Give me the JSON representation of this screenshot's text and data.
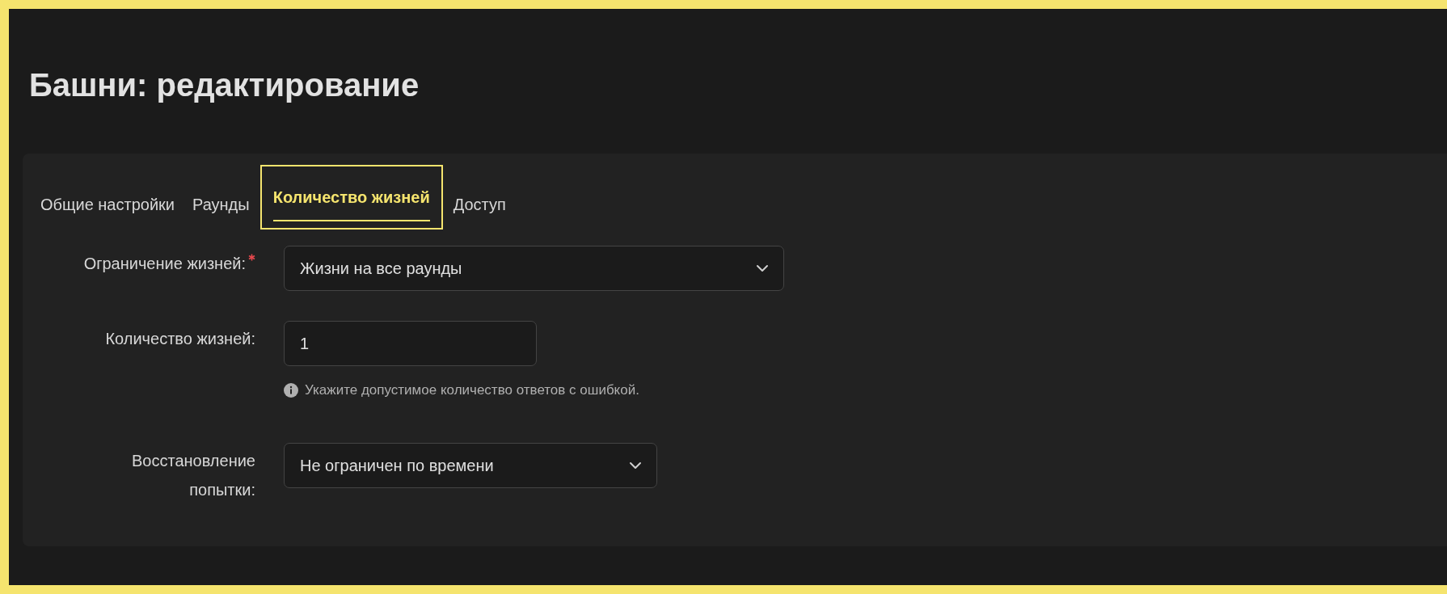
{
  "page": {
    "title": "Башни: редактирование"
  },
  "tabs": [
    {
      "label": "Общие настройки",
      "selected": false
    },
    {
      "label": "Раунды",
      "selected": false
    },
    {
      "label": "Количество жизней",
      "selected": true
    },
    {
      "label": "Доступ",
      "selected": false
    }
  ],
  "form": {
    "fields": [
      {
        "kind": "select",
        "label": "Ограничение жизней:",
        "required": true,
        "value": "Жизни на все раунды"
      },
      {
        "kind": "input",
        "label": "Количество жизней:",
        "required": false,
        "value": "1",
        "hint": "Укажите допустимое количество ответов с ошибкой."
      },
      {
        "kind": "select",
        "label": "Восстановление попытки:",
        "required": false,
        "value": "Не ограничен по времени"
      }
    ]
  }
}
